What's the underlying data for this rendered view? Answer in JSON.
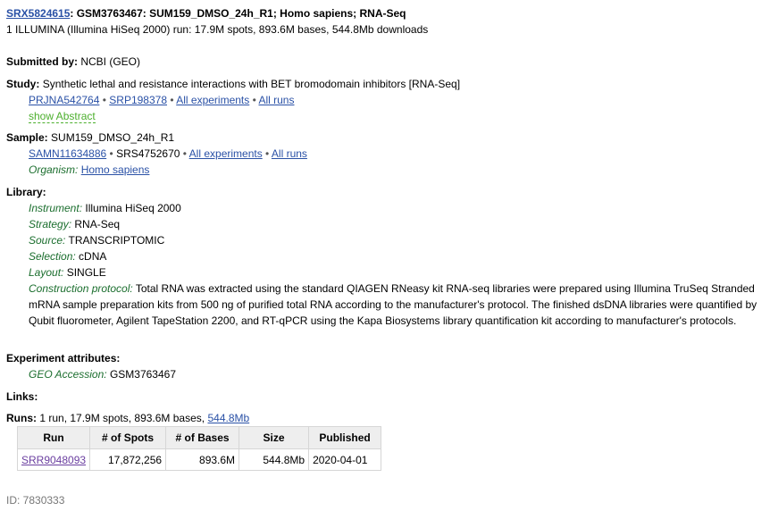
{
  "header": {
    "accession": "SRX5824615",
    "title": ": GSM3763467: SUM159_DMSO_24h_R1; Homo sapiens; RNA-Seq",
    "summary": "1 ILLUMINA (Illumina HiSeq 2000) run: 17.9M spots, 893.6M bases, 544.8Mb downloads"
  },
  "submitted": {
    "label": "Submitted by:",
    "value": "NCBI (GEO)"
  },
  "study": {
    "label": "Study:",
    "value": "Synthetic lethal and resistance interactions with BET bromodomain inhibitors [RNA-Seq]",
    "links": {
      "prj": "PRJNA542764",
      "srp": "SRP198378",
      "all_experiments": "All experiments",
      "all_runs": "All runs"
    },
    "show_abstract": "show Abstract"
  },
  "sample": {
    "label": "Sample:",
    "value": "SUM159_DMSO_24h_R1",
    "samn": "SAMN11634886",
    "srs": "SRS4752670",
    "all_experiments": "All experiments",
    "all_runs": "All runs",
    "organism_label": "Organism:",
    "organism": "Homo sapiens"
  },
  "library": {
    "label": "Library:",
    "instrument_label": "Instrument:",
    "instrument": "Illumina HiSeq 2000",
    "strategy_label": "Strategy:",
    "strategy": "RNA-Seq",
    "source_label": "Source:",
    "source": "TRANSCRIPTOMIC",
    "selection_label": "Selection:",
    "selection": "cDNA",
    "layout_label": "Layout:",
    "layout": "SINGLE",
    "protocol_label": "Construction protocol:",
    "protocol": "Total RNA was extracted using the standard QIAGEN RNeasy kit RNA-seq libraries were prepared using Illumina TruSeq Stranded mRNA sample preparation kits from 500 ng of purified total RNA according to the manufacturer's protocol. The finished dsDNA libraries were quantified by Qubit fluorometer, Agilent TapeStation 2200, and RT-qPCR using the Kapa Biosystems library quantification kit according to manufacturer's protocols."
  },
  "attributes": {
    "label": "Experiment attributes:",
    "geo_label": "GEO Accession:",
    "geo": "GSM3763467"
  },
  "links_label": "Links:",
  "runs": {
    "label": "Runs:",
    "summary": "1 run, 17.9M spots, 893.6M bases,",
    "download": "544.8Mb",
    "headers": [
      "Run",
      "# of Spots",
      "# of Bases",
      "Size",
      "Published"
    ],
    "rows": [
      {
        "run": "SRR9048093",
        "spots": "17,872,256",
        "bases": "893.6M",
        "size": "544.8Mb",
        "published": "2020-04-01"
      }
    ]
  },
  "footer_id": "ID: 7830333"
}
